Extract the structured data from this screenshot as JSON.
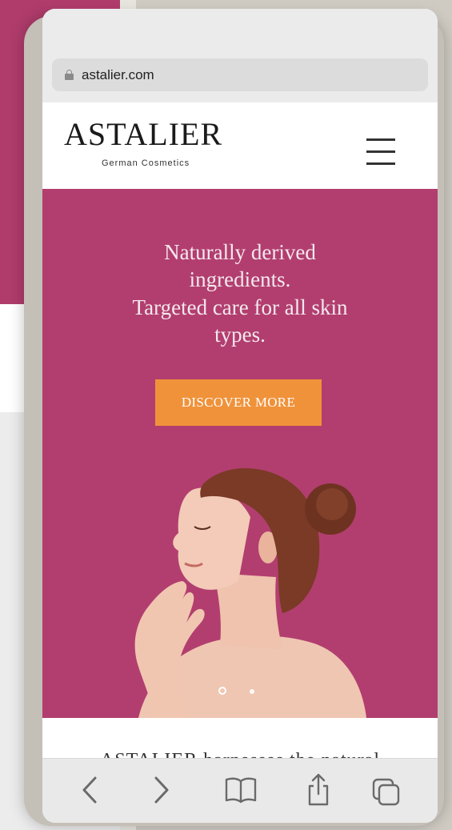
{
  "browser": {
    "url": "astalier.com"
  },
  "site": {
    "logo": "ASTALIER",
    "tagline": "German Cosmetics"
  },
  "hero": {
    "lines": [
      "Naturally derived",
      "ingredients.",
      "Targeted care for all skin",
      "types."
    ],
    "cta_label": "DISCOVER MORE",
    "slides_total": 2,
    "slide_active": 1
  },
  "intro": {
    "partial_text": "ASTALIER harnesses the natural"
  },
  "toolbar": {
    "icons": [
      "back-icon",
      "forward-icon",
      "bookmarks-icon",
      "share-icon",
      "tabs-icon"
    ]
  },
  "colors": {
    "brand_magenta": "#b23e6f",
    "cta_orange": "#f0923a"
  }
}
